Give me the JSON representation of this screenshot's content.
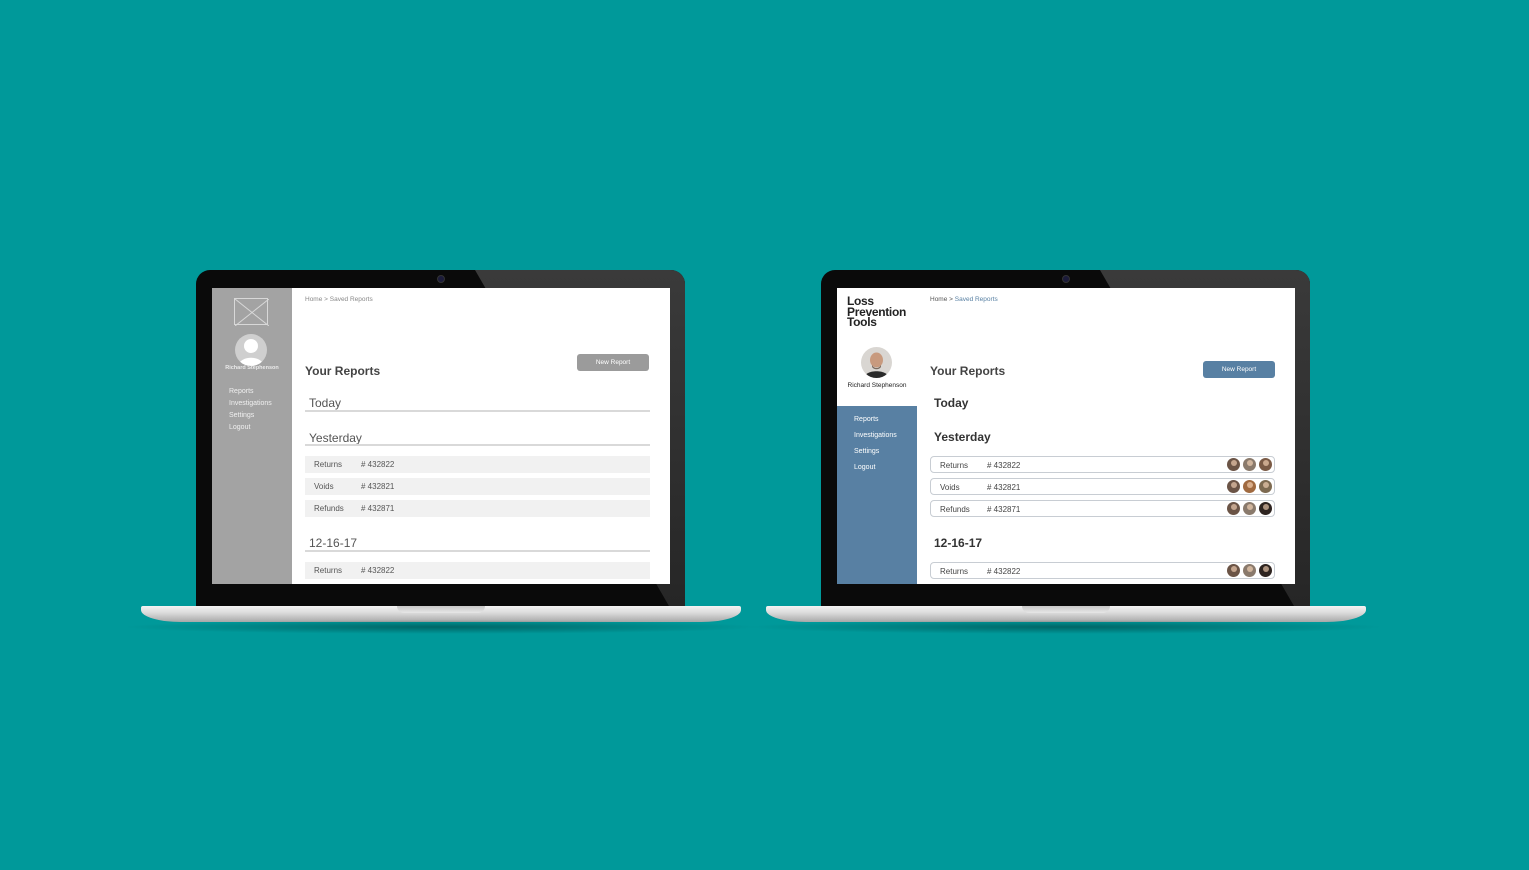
{
  "wireframe": {
    "breadcrumb": "Home > Saved Reports",
    "user_name": "Richard Stephenson",
    "nav": [
      "Reports",
      "Investigations",
      "Settings",
      "Logout"
    ],
    "page_title": "Your Reports",
    "new_report_label": "New Report",
    "sections": [
      "Today",
      "Yesterday",
      "12-16-17"
    ],
    "rows": [
      {
        "type": "Returns",
        "number": "# 432822"
      },
      {
        "type": "Voids",
        "number": "# 432821"
      },
      {
        "type": "Refunds",
        "number": "# 432871"
      },
      {
        "type": "Returns",
        "number": "# 432822"
      }
    ]
  },
  "styled": {
    "logo_lines": [
      "Loss",
      "Prevention",
      "Tools"
    ],
    "breadcrumb_home": "Home > ",
    "breadcrumb_current": "Saved Reports",
    "user_name": "Richard Stephenson",
    "nav": [
      "Reports",
      "Investigations",
      "Settings",
      "Logout"
    ],
    "page_title": "Your Reports",
    "new_report_label": "New Report",
    "sections": [
      "Today",
      "Yesterday",
      "12-16-17"
    ],
    "rows": [
      {
        "type": "Returns",
        "number": "# 432822"
      },
      {
        "type": "Voids",
        "number": "# 432821"
      },
      {
        "type": "Refunds",
        "number": "# 432871"
      },
      {
        "type": "Returns",
        "number": "# 432822"
      }
    ]
  },
  "colors": {
    "background": "#00999a",
    "accent": "#5880a3",
    "wireframe_gray": "#a3a3a3"
  }
}
